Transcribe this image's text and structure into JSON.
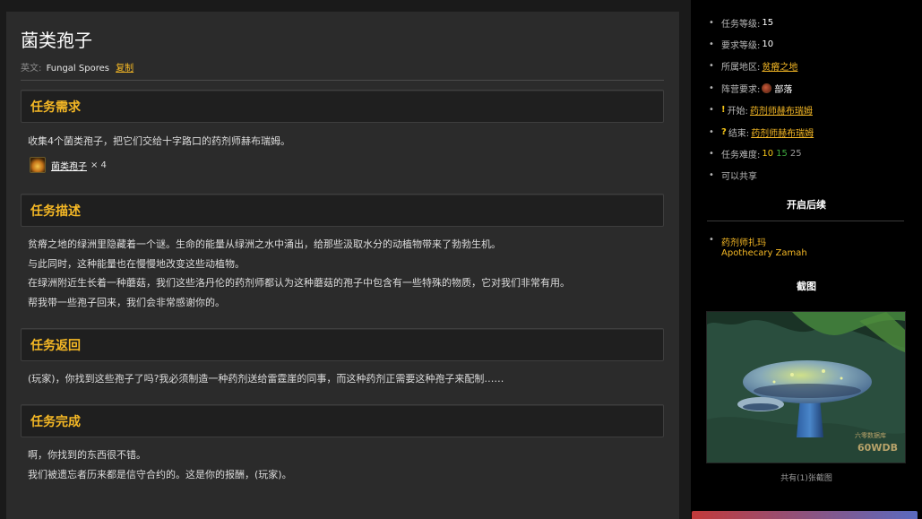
{
  "quest": {
    "title": "菌类孢子",
    "english_label": "英文:",
    "english_name": "Fungal Spores",
    "copy_label": "复制"
  },
  "sections": {
    "requirements": {
      "header": "任务需求",
      "text": "收集4个菌类孢子，把它们交给十字路口的药剂师赫布瑞姆。",
      "item": {
        "name": "菌类孢子",
        "quantity": "× 4",
        "icon": "fungal-spore-item-icon"
      }
    },
    "description": {
      "header": "任务描述",
      "lines": [
        "贫瘠之地的绿洲里隐藏着一个谜。生命的能量从绿洲之水中涌出，给那些汲取水分的动植物带来了勃勃生机。",
        "与此同时，这种能量也在慢慢地改变这些动植物。",
        "在绿洲附近生长着一种蘑菇，我们这些洛丹伦的药剂师都认为这种蘑菇的孢子中包含有一些特殊的物质，它对我们非常有用。",
        "帮我带一些孢子回来，我们会非常感谢你的。"
      ]
    },
    "return": {
      "header": "任务返回",
      "text": "(玩家)，你找到这些孢子了吗?我必须制造一种药剂送给雷霆崖的同事，而这种药剂正需要这种孢子来配制……"
    },
    "completion": {
      "header": "任务完成",
      "lines": [
        "啊，你找到的东西很不错。",
        "我们被遗忘者历来都是信守合约的。这是你的报酬，(玩家)。"
      ]
    }
  },
  "sidebar": {
    "info": {
      "quest_level_label": "任务等级:",
      "quest_level": "15",
      "req_level_label": "要求等级:",
      "req_level": "10",
      "zone_label": "所属地区:",
      "zone": "贫瘠之地",
      "faction_label": "阵营要求:",
      "faction": "部落",
      "start_label": "开始:",
      "start_npc": "药剂师赫布瑞姆",
      "end_label": "结束:",
      "end_npc": "药剂师赫布瑞姆",
      "difficulty_label": "任务难度:",
      "difficulty_1": "10",
      "difficulty_2": "15",
      "difficulty_3": "25",
      "shareable": "可以共享"
    },
    "followup_header": "开启后续",
    "followup": {
      "name_cn": "药剂师扎玛",
      "name_en": "Apothecary Zamah"
    },
    "screenshot_header": "截图",
    "screenshot_watermark_cn": "六零数据库",
    "screenshot_watermark_en": "60WDB",
    "screenshot_caption": "共有(1)张截图"
  },
  "colors": {
    "accent": "#f5b825",
    "panel": "#2b2b2b",
    "sidebar": "#000000",
    "difficulty_green": "#3ea83e"
  }
}
